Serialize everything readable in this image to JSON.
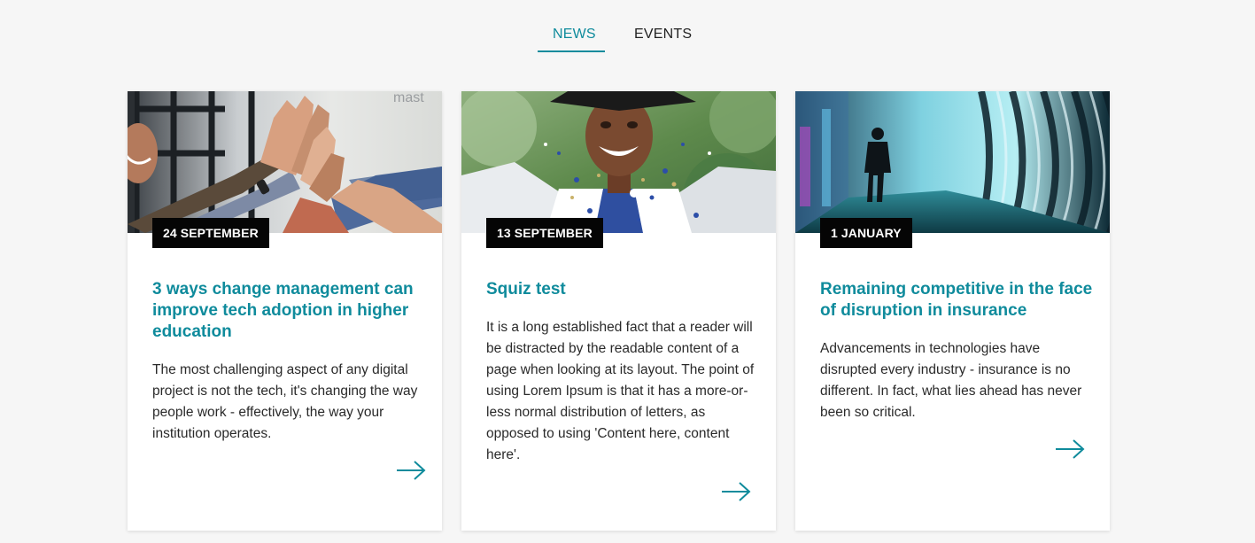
{
  "tabs": {
    "items": [
      {
        "label": "NEWS",
        "active": true
      },
      {
        "label": "EVENTS",
        "active": false
      }
    ],
    "accent_color": "#0f8b9c"
  },
  "cards": [
    {
      "date": "24 SEPTEMBER",
      "title": "3 ways change management can improve tech adoption in higher education",
      "text": "The most challenging aspect of any digital project is not the tech, it's changing the way people work - effectively, the way your institution operates.",
      "image_icon": "high-five-hands-image",
      "link_icon": "arrow-right-icon"
    },
    {
      "date": "13 SEPTEMBER",
      "title": "Squiz test",
      "text": "It is a long established fact that a reader will be distracted by the readable content of a page when looking at its layout. The point of using Lorem Ipsum is that it has a more-or-less normal distribution of letters, as opposed to using 'Content here, content here'.",
      "image_icon": "graduate-celebration-image",
      "link_icon": "arrow-right-icon"
    },
    {
      "date": "1 JANUARY",
      "title": "Remaining competitive in the face of disruption in insurance",
      "text": "Advancements in technologies have disrupted every industry - insurance is no different. In fact, what lies ahead has never been so critical.",
      "image_icon": "light-tunnel-image",
      "link_icon": "arrow-right-icon"
    }
  ],
  "colors": {
    "background": "#f6f6f6",
    "card_background": "#ffffff",
    "title": "#0f8b9c",
    "body_text": "#2a2a2a",
    "badge_background": "#050505",
    "badge_text": "#ffffff"
  }
}
